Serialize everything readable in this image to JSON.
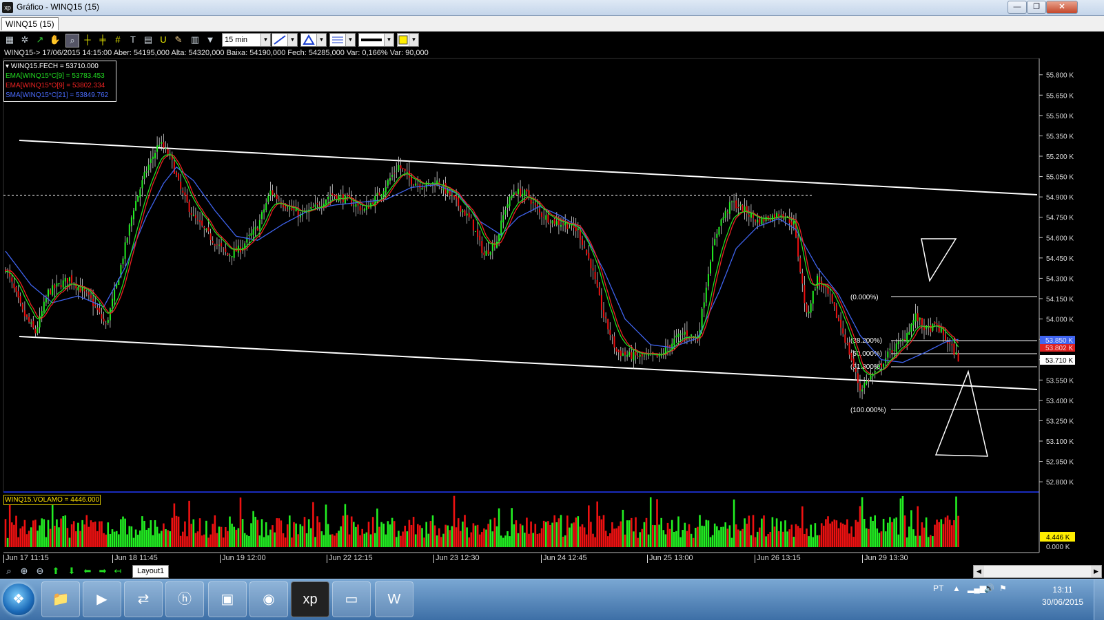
{
  "window": {
    "title": "Gráfico - WINQ15 (15)",
    "logo": "xp",
    "minimize": "—",
    "maximize": "❐",
    "close": "✕"
  },
  "tab": {
    "label": "WINQ15 (15)"
  },
  "toolbar": {
    "interval": "15 min",
    "icons": [
      "chart-type-icon",
      "settings-icon",
      "indicator-icon",
      "hand-icon",
      "zoom-window-icon",
      "crosshair-icon",
      "cursor-cross-icon",
      "grid-icon",
      "text-icon",
      "calculator-icon",
      "magnet-icon",
      "brush-icon",
      "trash-icon",
      "filter-icon"
    ]
  },
  "info_line": "WINQ15-> 17/06/2015 14:15:00 Aber: 54195,000 Alta: 54320,000 Baixa: 54190,000 Fech: 54285,000 Var: 0,166% Var: 90,000",
  "legend": [
    {
      "text": "▾ WINQ15.FECH = 53710.000",
      "color": "#ffffff"
    },
    {
      "text": "EMA[WINQ15*C[9] = 53783.453",
      "color": "#22dd22"
    },
    {
      "text": "EMA[WINQ15*O[9] = 53802.334",
      "color": "#ee2222"
    },
    {
      "text": "SMA[WINQ15*C[21] = 53849.762",
      "color": "#4a6cff"
    }
  ],
  "volume_legend": "WINQ15.VOLAMO = 4446.000",
  "x_labels": [
    "Jun 17 11:15",
    "Jun 18 11:45",
    "Jun 19 12:00",
    "Jun 22 12:15",
    "Jun 23 12:30",
    "Jun 24 12:45",
    "Jun 25 13:00",
    "Jun 26 13:15",
    "Jun 29 13:30"
  ],
  "fib_labels": [
    "(0.000%)",
    "(38.200%)",
    "(50.000%)",
    "(61.800%)",
    "(100.000%)"
  ],
  "price_tags": {
    "sma": {
      "text": "53.850 K",
      "color": "#3f64f0"
    },
    "ema": {
      "text": "53.802 K",
      "color": "#dd2222"
    },
    "last": {
      "text": "53.710 K",
      "color": "#ffffff"
    },
    "volume_last": {
      "text": "4.446 K",
      "color": "#ffee00"
    }
  },
  "bottom": {
    "layout_tab": "Layout1",
    "icons": [
      "zoom-fit-icon",
      "zoom-in-icon",
      "zoom-out-icon",
      "arrow-up-icon",
      "arrow-down-icon",
      "arrow-left-icon",
      "arrow-right-icon",
      "arrow-return-icon"
    ]
  },
  "taskbar": {
    "apps": [
      "folder-icon",
      "media-player-icon",
      "network-icon",
      "hp-icon",
      "scanner-icon",
      "chrome-icon",
      "xp-icon",
      "image-icon",
      "word-icon"
    ],
    "language": "PT",
    "time": "13:11",
    "date": "30/06/2015"
  },
  "colors": {
    "up": "#22ee22",
    "down": "#ee1111",
    "background": "#000000",
    "sma": "#3f64f0",
    "ema_close": "#22dd22",
    "ema_open": "#ee2222"
  },
  "chart_data": {
    "type": "line",
    "title": "",
    "xlabel": "",
    "ylabel": "",
    "ylim": [
      52750,
      55900
    ],
    "y_ticks": [
      "55.800 K",
      "55.650 K",
      "55.500 K",
      "55.350 K",
      "55.200 K",
      "55.050 K",
      "54.900 K",
      "54.750 K",
      "54.600 K",
      "54.450 K",
      "54.300 K",
      "54.150 K",
      "54.000 K",
      "53.850 K",
      "53.700 K",
      "53.550 K",
      "53.400 K",
      "53.250 K",
      "53.100 K",
      "52.950 K",
      "52.800 K"
    ],
    "y_tick_values": [
      55800,
      55650,
      55500,
      55350,
      55200,
      55050,
      54900,
      54750,
      54600,
      54450,
      54300,
      54150,
      54000,
      53850,
      53700,
      53550,
      53400,
      53250,
      53100,
      52950,
      52800
    ],
    "volume_ylim": [
      0,
      8000
    ],
    "volume_ticks": [
      "0.000 K"
    ],
    "close_path": [
      [
        0,
        54380
      ],
      [
        8,
        54050
      ],
      [
        14,
        53900
      ],
      [
        20,
        54200
      ],
      [
        30,
        54300
      ],
      [
        40,
        54140
      ],
      [
        47,
        53950
      ],
      [
        52,
        54250
      ],
      [
        60,
        54820
      ],
      [
        66,
        55100
      ],
      [
        72,
        55300
      ],
      [
        77,
        55200
      ],
      [
        82,
        54950
      ],
      [
        88,
        54750
      ],
      [
        96,
        54600
      ],
      [
        104,
        54470
      ],
      [
        110,
        54520
      ],
      [
        118,
        54680
      ],
      [
        124,
        54940
      ],
      [
        130,
        54850
      ],
      [
        138,
        54760
      ],
      [
        146,
        54830
      ],
      [
        152,
        54920
      ],
      [
        160,
        54880
      ],
      [
        168,
        54800
      ],
      [
        176,
        54940
      ],
      [
        184,
        55130
      ],
      [
        190,
        55020
      ],
      [
        196,
        54980
      ],
      [
        202,
        55010
      ],
      [
        210,
        54880
      ],
      [
        218,
        54720
      ],
      [
        224,
        54470
      ],
      [
        230,
        54580
      ],
      [
        234,
        54820
      ],
      [
        238,
        54940
      ],
      [
        244,
        54920
      ],
      [
        250,
        54780
      ],
      [
        256,
        54720
      ],
      [
        262,
        54700
      ],
      [
        268,
        54650
      ],
      [
        274,
        54400
      ],
      [
        280,
        54020
      ],
      [
        286,
        53760
      ],
      [
        292,
        53730
      ],
      [
        298,
        53720
      ],
      [
        306,
        53720
      ],
      [
        314,
        53860
      ],
      [
        318,
        53900
      ],
      [
        324,
        53850
      ],
      [
        330,
        54450
      ],
      [
        334,
        54700
      ],
      [
        340,
        54860
      ],
      [
        346,
        54800
      ],
      [
        352,
        54720
      ],
      [
        358,
        54750
      ],
      [
        363,
        54780
      ],
      [
        369,
        54700
      ],
      [
        375,
        54020
      ],
      [
        380,
        54300
      ],
      [
        386,
        54150
      ],
      [
        392,
        53900
      ],
      [
        396,
        53700
      ],
      [
        400,
        53480
      ],
      [
        404,
        53560
      ],
      [
        408,
        53620
      ],
      [
        414,
        53760
      ],
      [
        420,
        53840
      ],
      [
        426,
        54020
      ],
      [
        431,
        53920
      ],
      [
        436,
        53950
      ],
      [
        441,
        53830
      ],
      [
        446,
        53710
      ]
    ],
    "sma_path": [
      [
        0,
        54500
      ],
      [
        12,
        54250
      ],
      [
        22,
        54120
      ],
      [
        34,
        54170
      ],
      [
        46,
        54090
      ],
      [
        56,
        54380
      ],
      [
        66,
        54760
      ],
      [
        74,
        55000
      ],
      [
        80,
        55120
      ],
      [
        88,
        55020
      ],
      [
        98,
        54800
      ],
      [
        108,
        54610
      ],
      [
        118,
        54580
      ],
      [
        130,
        54700
      ],
      [
        142,
        54800
      ],
      [
        154,
        54840
      ],
      [
        166,
        54860
      ],
      [
        178,
        54880
      ],
      [
        190,
        54970
      ],
      [
        202,
        54990
      ],
      [
        212,
        54920
      ],
      [
        222,
        54720
      ],
      [
        232,
        54620
      ],
      [
        240,
        54750
      ],
      [
        250,
        54830
      ],
      [
        260,
        54760
      ],
      [
        270,
        54660
      ],
      [
        280,
        54360
      ],
      [
        290,
        54000
      ],
      [
        302,
        53810
      ],
      [
        312,
        53790
      ],
      [
        324,
        53860
      ],
      [
        334,
        54200
      ],
      [
        342,
        54520
      ],
      [
        352,
        54680
      ],
      [
        362,
        54740
      ],
      [
        370,
        54660
      ],
      [
        380,
        54380
      ],
      [
        390,
        54180
      ],
      [
        400,
        53880
      ],
      [
        410,
        53700
      ],
      [
        420,
        53680
      ],
      [
        430,
        53750
      ],
      [
        440,
        53830
      ],
      [
        446,
        53850
      ]
    ]
  }
}
